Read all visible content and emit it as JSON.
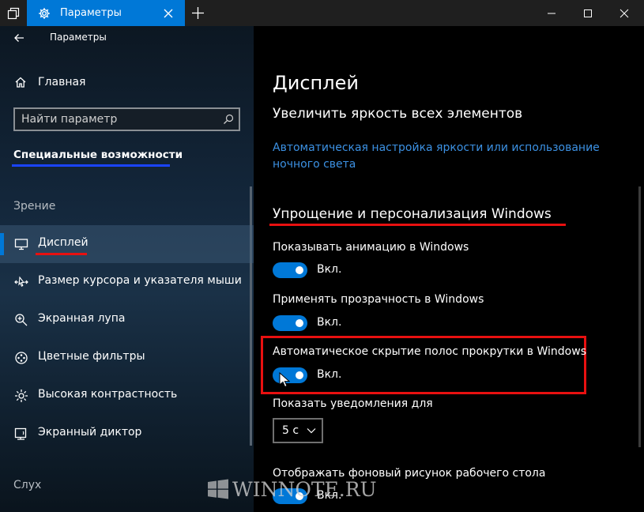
{
  "window": {
    "tab_title": "Параметры"
  },
  "sidebar": {
    "back_title": "Параметры",
    "home_label": "Главная",
    "search_placeholder": "Найти параметр",
    "section_title": "Специальные возможности",
    "group_vision": "Зрение",
    "items": [
      {
        "label": "Дисплей",
        "icon": "display-icon",
        "active": true
      },
      {
        "label": "Размер курсора и указателя мыши",
        "icon": "cursor-size-icon",
        "active": false
      },
      {
        "label": "Экранная лупа",
        "icon": "magnifier-icon",
        "active": false
      },
      {
        "label": "Цветные фильтры",
        "icon": "color-filters-icon",
        "active": false
      },
      {
        "label": "Высокая контрастность",
        "icon": "high-contrast-icon",
        "active": false
      },
      {
        "label": "Экранный диктор",
        "icon": "narrator-icon",
        "active": false
      }
    ],
    "group_hearing": "Слух"
  },
  "main": {
    "title": "Дисплей",
    "brightness_heading": "Увеличить яркость всех элементов",
    "brightness_link": "Автоматическая настройка яркости или использование ночного света",
    "simplify_heading": "Упрощение и персонализация Windows",
    "settings": [
      {
        "label": "Показывать анимацию в Windows",
        "state": "Вкл.",
        "on": true
      },
      {
        "label": "Применять прозрачность в Windows",
        "state": "Вкл.",
        "on": true
      },
      {
        "label": "Автоматическое скрытие полос прокрутки в Windows",
        "state": "Вкл.",
        "on": true
      }
    ],
    "notifications_label": "Показать уведомления для",
    "notifications_value": "5 с",
    "wallpaper_label": "Отображать фоновый рисунок рабочего стола",
    "wallpaper_state": "Вкл."
  },
  "watermark": {
    "text": "WINNOTE.RU"
  },
  "colors": {
    "accent": "#0078d7",
    "highlight_red": "#e81010",
    "highlight_blue": "#1a44ff",
    "link": "#3c91e3"
  }
}
